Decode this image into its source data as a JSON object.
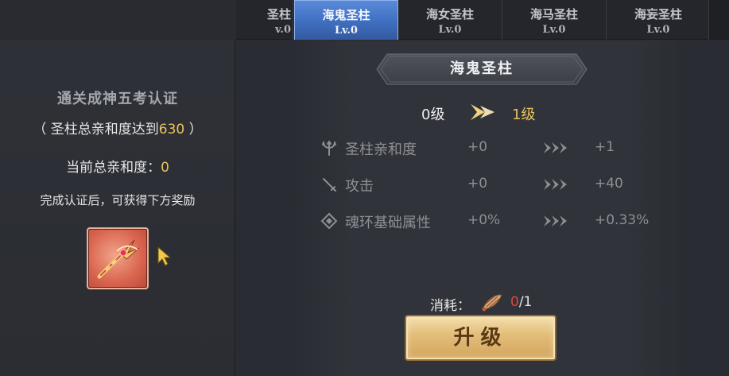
{
  "left_panel": {
    "title": "通关成神五考认证",
    "requirement_prefix": "（ 圣柱总亲和度达到",
    "requirement_value": "630",
    "requirement_suffix": " ）",
    "current_label": "当前总亲和度：",
    "current_value": "0",
    "reward_note": "完成认证后，可获得下方奖励",
    "reward_icon": "trident-weapon-icon"
  },
  "tabs": [
    {
      "name": "圣柱",
      "level": "v.0"
    },
    {
      "name": "海鬼圣柱",
      "level": "Lv.0",
      "active": true
    },
    {
      "name": "海女圣柱",
      "level": "Lv.0"
    },
    {
      "name": "海马圣柱",
      "level": "Lv.0"
    },
    {
      "name": "海妄圣柱",
      "level": "Lv.0"
    }
  ],
  "detail": {
    "title": "海鬼圣柱",
    "level_from": "0级",
    "level_to": "1级",
    "stats": [
      {
        "icon": "trident-icon",
        "label": "圣柱亲和度",
        "current": "+0",
        "next": "+1"
      },
      {
        "icon": "sword-icon",
        "label": "攻击",
        "current": "+0",
        "next": "+40"
      },
      {
        "icon": "diamond-icon",
        "label": "魂环基础属性",
        "current": "+0%",
        "next": "+0.33%"
      }
    ],
    "consume_label": "消耗：",
    "consume_have": "0",
    "consume_need": "/1",
    "upgrade_label": "升级"
  },
  "colors": {
    "gold": "#e8c35a",
    "active_tab": "#4a7bcf",
    "red": "#e2443c",
    "button": "#e2bc78"
  }
}
